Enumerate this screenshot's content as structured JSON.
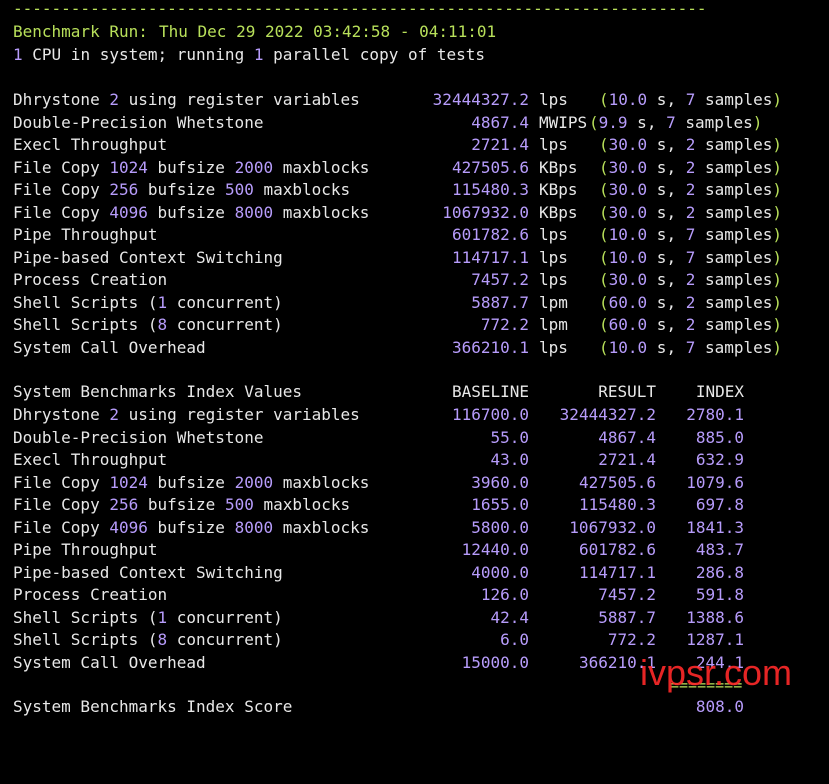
{
  "header": {
    "rule": "------------------------------------------------------------------------",
    "run_label": "Benchmark Run:",
    "run_time": "Thu Dec 29 2022 03:42:58 - 04:11:01",
    "cpu_count": "1",
    "cpu_text": " CPU in system; running ",
    "parallel_count": "1",
    "parallel_text": " parallel copy of tests"
  },
  "results": [
    {
      "pre": "Dhrystone ",
      "n1": "2",
      "mid": " using register variables",
      "n2": "",
      "post": "",
      "value": "32444327.2",
      "unit": "lps",
      "time": "10.0",
      "samples": "7"
    },
    {
      "pre": "Double-Precision Whetstone",
      "n1": "",
      "mid": "",
      "n2": "",
      "post": "",
      "value": "4867.4",
      "unit": "MWIPS",
      "time": "9.9",
      "samples": "7"
    },
    {
      "pre": "Execl Throughput",
      "n1": "",
      "mid": "",
      "n2": "",
      "post": "",
      "value": "2721.4",
      "unit": "lps",
      "time": "30.0",
      "samples": "2"
    },
    {
      "pre": "File Copy ",
      "n1": "1024",
      "mid": " bufsize ",
      "n2": "2000",
      "post": " maxblocks",
      "value": "427505.6",
      "unit": "KBps",
      "time": "30.0",
      "samples": "2"
    },
    {
      "pre": "File Copy ",
      "n1": "256",
      "mid": " bufsize ",
      "n2": "500",
      "post": " maxblocks",
      "value": "115480.3",
      "unit": "KBps",
      "time": "30.0",
      "samples": "2"
    },
    {
      "pre": "File Copy ",
      "n1": "4096",
      "mid": " bufsize ",
      "n2": "8000",
      "post": " maxblocks",
      "value": "1067932.0",
      "unit": "KBps",
      "time": "30.0",
      "samples": "2"
    },
    {
      "pre": "Pipe Throughput",
      "n1": "",
      "mid": "",
      "n2": "",
      "post": "",
      "value": "601782.6",
      "unit": "lps",
      "time": "10.0",
      "samples": "7"
    },
    {
      "pre": "Pipe-based Context Switching",
      "n1": "",
      "mid": "",
      "n2": "",
      "post": "",
      "value": "114717.1",
      "unit": "lps",
      "time": "10.0",
      "samples": "7"
    },
    {
      "pre": "Process Creation",
      "n1": "",
      "mid": "",
      "n2": "",
      "post": "",
      "value": "7457.2",
      "unit": "lps",
      "time": "30.0",
      "samples": "2"
    },
    {
      "pre": "Shell Scripts (",
      "n1": "1",
      "mid": " concurrent)",
      "n2": "",
      "post": "",
      "value": "5887.7",
      "unit": "lpm",
      "time": "60.0",
      "samples": "2"
    },
    {
      "pre": "Shell Scripts (",
      "n1": "8",
      "mid": " concurrent)",
      "n2": "",
      "post": "",
      "value": "772.2",
      "unit": "lpm",
      "time": "60.0",
      "samples": "2"
    },
    {
      "pre": "System Call Overhead",
      "n1": "",
      "mid": "",
      "n2": "",
      "post": "",
      "value": "366210.1",
      "unit": "lps",
      "time": "10.0",
      "samples": "7"
    }
  ],
  "index_header": {
    "title": "System Benchmarks Index Values",
    "baseline": "BASELINE",
    "result": "RESULT",
    "index": "INDEX"
  },
  "index_rows": [
    {
      "pre": "Dhrystone ",
      "n1": "2",
      "mid": " using register variables",
      "n2": "",
      "post": "",
      "baseline": "116700.0",
      "result": "32444327.2",
      "index": "2780.1"
    },
    {
      "pre": "Double-Precision Whetstone",
      "n1": "",
      "mid": "",
      "n2": "",
      "post": "",
      "baseline": "55.0",
      "result": "4867.4",
      "index": "885.0"
    },
    {
      "pre": "Execl Throughput",
      "n1": "",
      "mid": "",
      "n2": "",
      "post": "",
      "baseline": "43.0",
      "result": "2721.4",
      "index": "632.9"
    },
    {
      "pre": "File Copy ",
      "n1": "1024",
      "mid": " bufsize ",
      "n2": "2000",
      "post": " maxblocks",
      "baseline": "3960.0",
      "result": "427505.6",
      "index": "1079.6"
    },
    {
      "pre": "File Copy ",
      "n1": "256",
      "mid": " bufsize ",
      "n2": "500",
      "post": " maxblocks",
      "baseline": "1655.0",
      "result": "115480.3",
      "index": "697.8"
    },
    {
      "pre": "File Copy ",
      "n1": "4096",
      "mid": " bufsize ",
      "n2": "8000",
      "post": " maxblocks",
      "baseline": "5800.0",
      "result": "1067932.0",
      "index": "1841.3"
    },
    {
      "pre": "Pipe Throughput",
      "n1": "",
      "mid": "",
      "n2": "",
      "post": "",
      "baseline": "12440.0",
      "result": "601782.6",
      "index": "483.7"
    },
    {
      "pre": "Pipe-based Context Switching",
      "n1": "",
      "mid": "",
      "n2": "",
      "post": "",
      "baseline": "4000.0",
      "result": "114717.1",
      "index": "286.8"
    },
    {
      "pre": "Process Creation",
      "n1": "",
      "mid": "",
      "n2": "",
      "post": "",
      "baseline": "126.0",
      "result": "7457.2",
      "index": "591.8"
    },
    {
      "pre": "Shell Scripts (",
      "n1": "1",
      "mid": " concurrent)",
      "n2": "",
      "post": "",
      "baseline": "42.4",
      "result": "5887.7",
      "index": "1388.6"
    },
    {
      "pre": "Shell Scripts (",
      "n1": "8",
      "mid": " concurrent)",
      "n2": "",
      "post": "",
      "baseline": "6.0",
      "result": "772.2",
      "index": "1287.1"
    },
    {
      "pre": "System Call Overhead",
      "n1": "",
      "mid": "",
      "n2": "",
      "post": "",
      "baseline": "15000.0",
      "result": "366210.1",
      "index": "244.1"
    }
  ],
  "score": {
    "rule": "========",
    "label": "System Benchmarks Index Score",
    "value": "808.0"
  },
  "watermark": "ivpsr.com",
  "colors": {
    "background": "#000000",
    "text": "#e8e8e8",
    "green": "#b8e05a",
    "number": "#b79cfb",
    "watermark": "#ff2a2a"
  }
}
